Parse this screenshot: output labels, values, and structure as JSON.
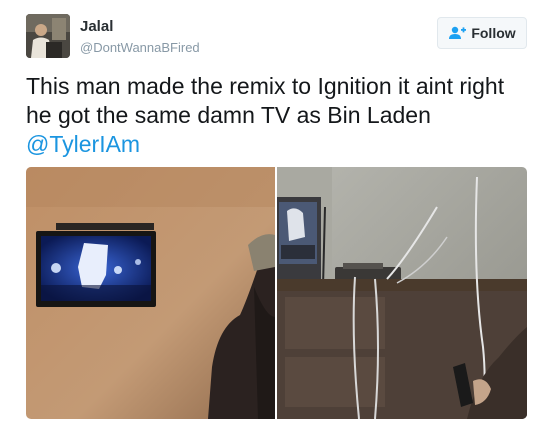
{
  "user": {
    "name": "Jalal",
    "handle": "@DontWannaBFired"
  },
  "follow_button": {
    "label": "Follow"
  },
  "tweet": {
    "text": "This man made the remix to Ignition it aint right he got the same damn TV as Bin Laden",
    "mention": "@TylerIAm"
  },
  "icons": {
    "follow": "person-plus-icon"
  },
  "colors": {
    "link": "#1b95e0",
    "handle": "#8899a6",
    "button_bg": "#f5f8fa",
    "button_border": "#e1e8ed"
  }
}
